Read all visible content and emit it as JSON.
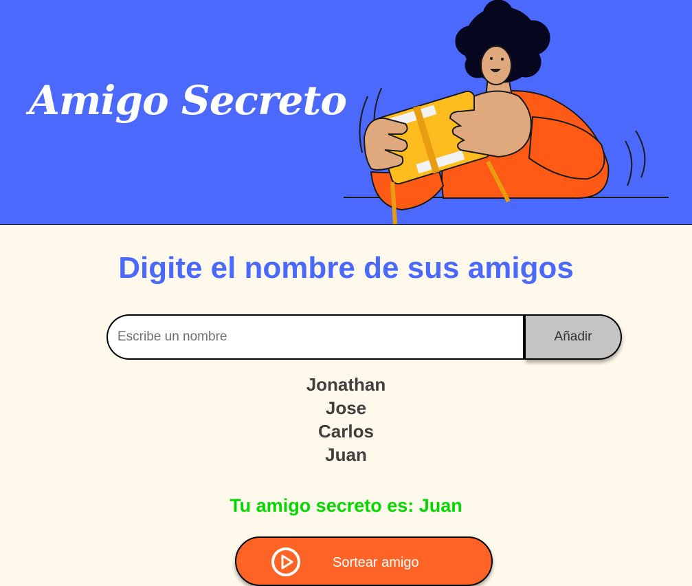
{
  "header": {
    "title": "Amigo Secreto",
    "background_color": "#4b69fd",
    "illustration": "person-holding-gift-box-illustration"
  },
  "main": {
    "heading": "Digite el nombre de sus amigos",
    "input": {
      "placeholder": "Escribe un nombre",
      "value": ""
    },
    "add_button_label": "Añadir",
    "friends": [
      "Jonathan",
      "Jose",
      "Carlos",
      "Juan"
    ],
    "result_text": "Tu amigo secreto es: Juan",
    "draw_button_label": "Sortear amigo",
    "draw_button_icon": "play-circle-icon"
  },
  "colors": {
    "background": "#fff9eb",
    "accent": "#4b69fd",
    "button_orange": "#ff6426",
    "result_green": "#05d600",
    "add_button_gray": "#c4c4c4"
  }
}
